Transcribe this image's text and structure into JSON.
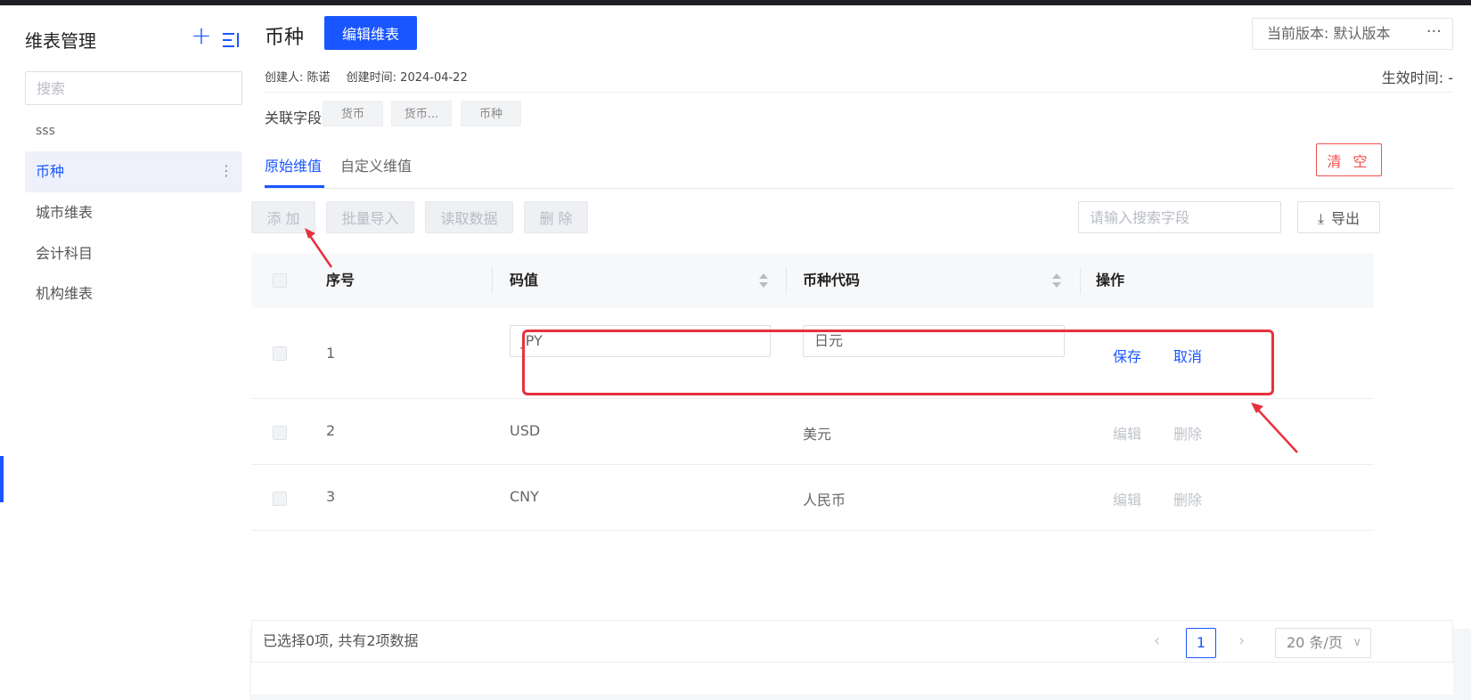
{
  "sidebar": {
    "title": "维表管理",
    "search_placeholder": "搜索",
    "group_label": "sss",
    "items": [
      {
        "label": "币种",
        "active": true
      },
      {
        "label": "城市维表"
      },
      {
        "label": "会计科目"
      },
      {
        "label": "机构维表"
      }
    ],
    "icons": {
      "add": "plus-icon",
      "menu": "menu-collapse-icon",
      "more": "kebab-icon"
    }
  },
  "header": {
    "title": "币种",
    "edit_label": "编辑维表",
    "version_label": "当前版本: 默认版本",
    "more_label": "···"
  },
  "meta": {
    "creator": "创建人: 陈诺",
    "created_time": "创建时间: 2024-04-22",
    "effective_time": "生效时间: -"
  },
  "related": {
    "label": "关联字段:",
    "chips": [
      "货币",
      "货币...",
      "币种"
    ]
  },
  "tabs": [
    {
      "label": "原始维值",
      "active": true
    },
    {
      "label": "自定义维值"
    }
  ],
  "toolbar": {
    "clear_label": "清 空",
    "add_label": "添 加",
    "import_label": "批量导入",
    "read_label": "读取数据",
    "delete_label": "删 除",
    "search_placeholder": "请输入搜索字段",
    "export_label": "导出"
  },
  "table": {
    "columns": [
      "序号",
      "码值",
      "币种代码",
      "操作"
    ],
    "rows": [
      {
        "index": "1",
        "code": "JPY",
        "name": "日元",
        "actions": [
          "保存",
          "取消"
        ],
        "editing": true
      },
      {
        "index": "2",
        "code": "USD",
        "name": "美元",
        "actions": [
          "编辑",
          "删除"
        ]
      },
      {
        "index": "3",
        "code": "CNY",
        "name": "人民币",
        "actions": [
          "编辑",
          "删除"
        ]
      }
    ]
  },
  "footer": {
    "selected_info": "已选择0项, 共有2项数据",
    "current_page": "1",
    "prev": "‹",
    "next": "›",
    "page_size": "20 条/页"
  },
  "colors": {
    "accent": "#1a56ff",
    "danger": "#f05050",
    "annotation": "#e7313e"
  }
}
